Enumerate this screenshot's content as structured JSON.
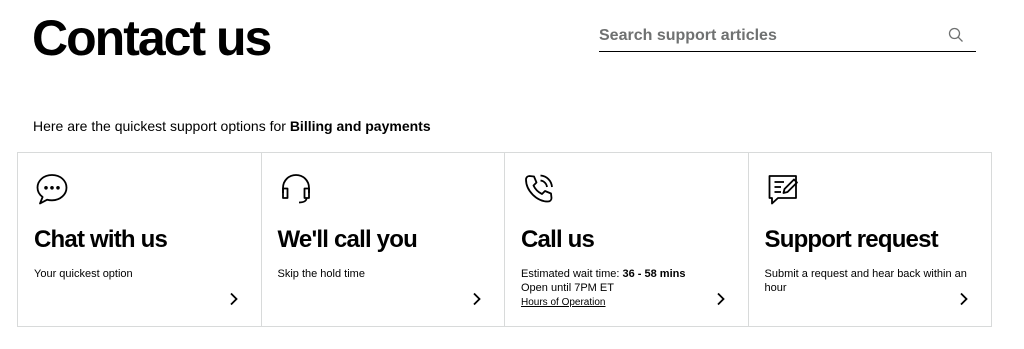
{
  "page": {
    "title": "Contact us"
  },
  "search": {
    "placeholder": "Search support articles",
    "icon": "search-icon"
  },
  "intro": {
    "prefix": "Here are the quickest support options for",
    "topic": "Billing and payments"
  },
  "cards": [
    {
      "icon": "chat-bubble-icon",
      "title": "Chat with us",
      "description": "Your quickest option"
    },
    {
      "icon": "headset-icon",
      "title": "We'll call you",
      "description": "Skip the hold time"
    },
    {
      "icon": "phone-ringing-icon",
      "title": "Call us",
      "wait_label": "Estimated wait time:",
      "wait_value": "36 - 58 mins",
      "hours_text": "Open until 7PM ET",
      "hours_link": "Hours of Operation"
    },
    {
      "icon": "document-edit-icon",
      "title": "Support request",
      "description": "Submit a request and hear back within an hour"
    }
  ]
}
